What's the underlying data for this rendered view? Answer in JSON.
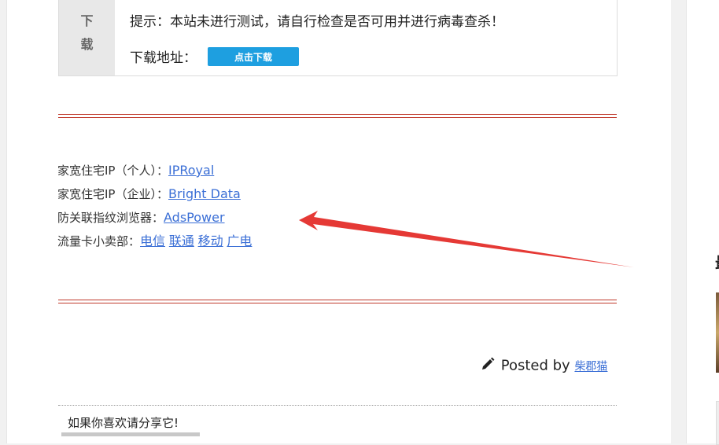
{
  "download_box": {
    "side_chars": [
      "下",
      "载"
    ],
    "tip": "提示：本站未进行测试，请自行检查是否可用并进行病毒查杀！",
    "addr_label": "下载地址：",
    "button_label": "点击下载"
  },
  "links": [
    {
      "label": "家宽住宅IP（个人）：",
      "items": [
        "IPRoyal"
      ]
    },
    {
      "label": "家宽住宅IP（企业）：",
      "items": [
        "Bright Data"
      ]
    },
    {
      "label": "防关联指纹浏览器：",
      "items": [
        "AdsPower"
      ]
    },
    {
      "label": "流量卡小卖部：",
      "items": [
        "电信",
        "联通",
        "移动",
        "广电"
      ]
    }
  ],
  "posted": {
    "prefix": "Posted by",
    "author": "柴郡猫"
  },
  "share": {
    "label": "如果你喜欢请分享它!"
  },
  "right_panel": {
    "glyph": "最"
  },
  "colors": {
    "accent": "#1e9fe0",
    "link": "#3b6fd6",
    "rule": "#c0392b",
    "arrow": "#e53935"
  }
}
